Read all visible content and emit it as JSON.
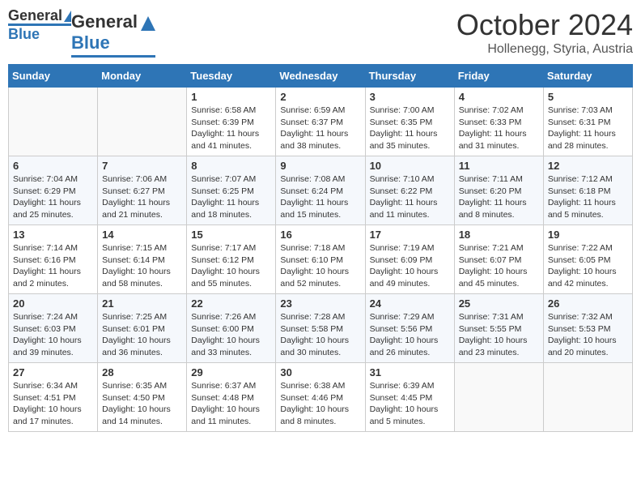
{
  "header": {
    "logo_general": "General",
    "logo_blue": "Blue",
    "month": "October 2024",
    "location": "Hollenegg, Styria, Austria"
  },
  "days_of_week": [
    "Sunday",
    "Monday",
    "Tuesday",
    "Wednesday",
    "Thursday",
    "Friday",
    "Saturday"
  ],
  "weeks": [
    [
      {
        "day": "",
        "info": ""
      },
      {
        "day": "",
        "info": ""
      },
      {
        "day": "1",
        "info": "Sunrise: 6:58 AM\nSunset: 6:39 PM\nDaylight: 11 hours and 41 minutes."
      },
      {
        "day": "2",
        "info": "Sunrise: 6:59 AM\nSunset: 6:37 PM\nDaylight: 11 hours and 38 minutes."
      },
      {
        "day": "3",
        "info": "Sunrise: 7:00 AM\nSunset: 6:35 PM\nDaylight: 11 hours and 35 minutes."
      },
      {
        "day": "4",
        "info": "Sunrise: 7:02 AM\nSunset: 6:33 PM\nDaylight: 11 hours and 31 minutes."
      },
      {
        "day": "5",
        "info": "Sunrise: 7:03 AM\nSunset: 6:31 PM\nDaylight: 11 hours and 28 minutes."
      }
    ],
    [
      {
        "day": "6",
        "info": "Sunrise: 7:04 AM\nSunset: 6:29 PM\nDaylight: 11 hours and 25 minutes."
      },
      {
        "day": "7",
        "info": "Sunrise: 7:06 AM\nSunset: 6:27 PM\nDaylight: 11 hours and 21 minutes."
      },
      {
        "day": "8",
        "info": "Sunrise: 7:07 AM\nSunset: 6:25 PM\nDaylight: 11 hours and 18 minutes."
      },
      {
        "day": "9",
        "info": "Sunrise: 7:08 AM\nSunset: 6:24 PM\nDaylight: 11 hours and 15 minutes."
      },
      {
        "day": "10",
        "info": "Sunrise: 7:10 AM\nSunset: 6:22 PM\nDaylight: 11 hours and 11 minutes."
      },
      {
        "day": "11",
        "info": "Sunrise: 7:11 AM\nSunset: 6:20 PM\nDaylight: 11 hours and 8 minutes."
      },
      {
        "day": "12",
        "info": "Sunrise: 7:12 AM\nSunset: 6:18 PM\nDaylight: 11 hours and 5 minutes."
      }
    ],
    [
      {
        "day": "13",
        "info": "Sunrise: 7:14 AM\nSunset: 6:16 PM\nDaylight: 11 hours and 2 minutes."
      },
      {
        "day": "14",
        "info": "Sunrise: 7:15 AM\nSunset: 6:14 PM\nDaylight: 10 hours and 58 minutes."
      },
      {
        "day": "15",
        "info": "Sunrise: 7:17 AM\nSunset: 6:12 PM\nDaylight: 10 hours and 55 minutes."
      },
      {
        "day": "16",
        "info": "Sunrise: 7:18 AM\nSunset: 6:10 PM\nDaylight: 10 hours and 52 minutes."
      },
      {
        "day": "17",
        "info": "Sunrise: 7:19 AM\nSunset: 6:09 PM\nDaylight: 10 hours and 49 minutes."
      },
      {
        "day": "18",
        "info": "Sunrise: 7:21 AM\nSunset: 6:07 PM\nDaylight: 10 hours and 45 minutes."
      },
      {
        "day": "19",
        "info": "Sunrise: 7:22 AM\nSunset: 6:05 PM\nDaylight: 10 hours and 42 minutes."
      }
    ],
    [
      {
        "day": "20",
        "info": "Sunrise: 7:24 AM\nSunset: 6:03 PM\nDaylight: 10 hours and 39 minutes."
      },
      {
        "day": "21",
        "info": "Sunrise: 7:25 AM\nSunset: 6:01 PM\nDaylight: 10 hours and 36 minutes."
      },
      {
        "day": "22",
        "info": "Sunrise: 7:26 AM\nSunset: 6:00 PM\nDaylight: 10 hours and 33 minutes."
      },
      {
        "day": "23",
        "info": "Sunrise: 7:28 AM\nSunset: 5:58 PM\nDaylight: 10 hours and 30 minutes."
      },
      {
        "day": "24",
        "info": "Sunrise: 7:29 AM\nSunset: 5:56 PM\nDaylight: 10 hours and 26 minutes."
      },
      {
        "day": "25",
        "info": "Sunrise: 7:31 AM\nSunset: 5:55 PM\nDaylight: 10 hours and 23 minutes."
      },
      {
        "day": "26",
        "info": "Sunrise: 7:32 AM\nSunset: 5:53 PM\nDaylight: 10 hours and 20 minutes."
      }
    ],
    [
      {
        "day": "27",
        "info": "Sunrise: 6:34 AM\nSunset: 4:51 PM\nDaylight: 10 hours and 17 minutes."
      },
      {
        "day": "28",
        "info": "Sunrise: 6:35 AM\nSunset: 4:50 PM\nDaylight: 10 hours and 14 minutes."
      },
      {
        "day": "29",
        "info": "Sunrise: 6:37 AM\nSunset: 4:48 PM\nDaylight: 10 hours and 11 minutes."
      },
      {
        "day": "30",
        "info": "Sunrise: 6:38 AM\nSunset: 4:46 PM\nDaylight: 10 hours and 8 minutes."
      },
      {
        "day": "31",
        "info": "Sunrise: 6:39 AM\nSunset: 4:45 PM\nDaylight: 10 hours and 5 minutes."
      },
      {
        "day": "",
        "info": ""
      },
      {
        "day": "",
        "info": ""
      }
    ]
  ]
}
